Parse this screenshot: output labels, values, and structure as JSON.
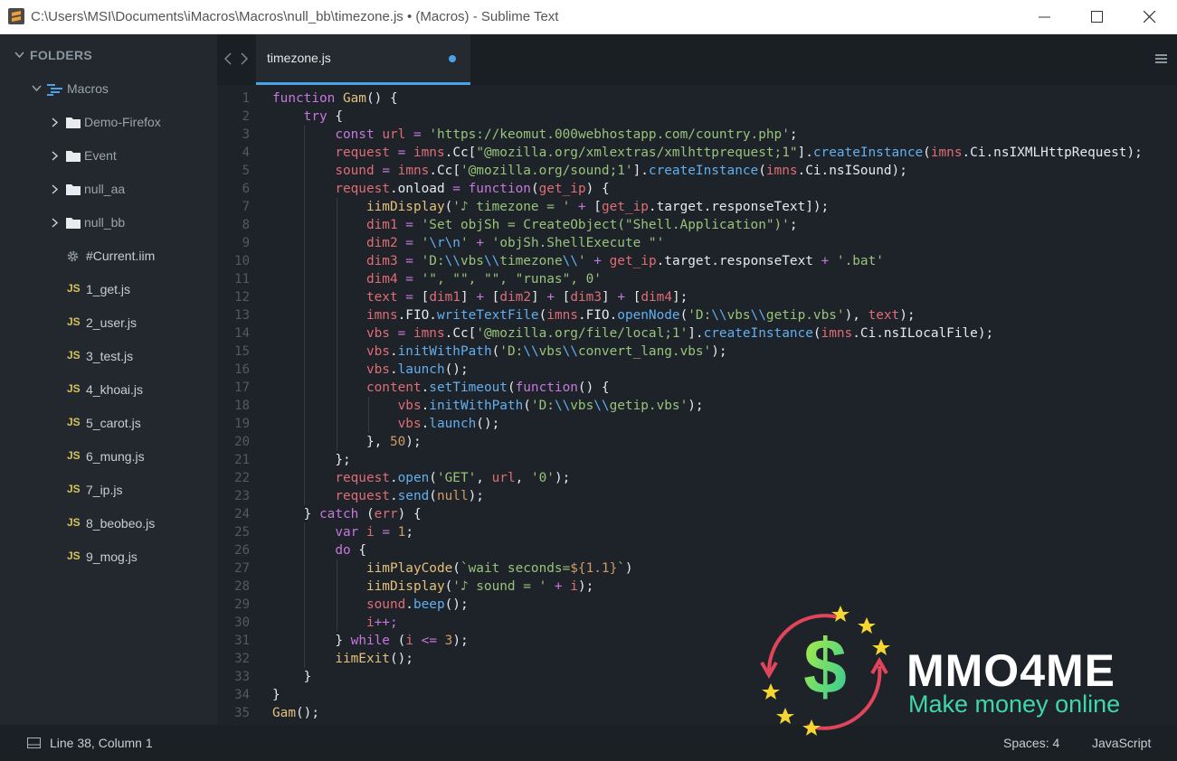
{
  "window": {
    "title": "C:\\Users\\MSI\\Documents\\iMacros\\Macros\\null_bb\\timezone.js • (Macros) - Sublime Text"
  },
  "sidebar": {
    "header": "FOLDERS",
    "root": "Macros",
    "folders": [
      "Demo-Firefox",
      "Event",
      "null_aa",
      "null_bb"
    ],
    "files": [
      {
        "name": "#Current.iim",
        "icon": "gear-icon"
      },
      {
        "name": "1_get.js",
        "icon": "js-file-icon"
      },
      {
        "name": "2_user.js",
        "icon": "js-file-icon"
      },
      {
        "name": "3_test.js",
        "icon": "js-file-icon"
      },
      {
        "name": "4_khoai.js",
        "icon": "js-file-icon"
      },
      {
        "name": "5_carot.js",
        "icon": "js-file-icon"
      },
      {
        "name": "6_mung.js",
        "icon": "js-file-icon"
      },
      {
        "name": "7_ip.js",
        "icon": "js-file-icon"
      },
      {
        "name": "8_beobeo.js",
        "icon": "js-file-icon"
      },
      {
        "name": "9_mog.js",
        "icon": "js-file-icon"
      }
    ],
    "js_badge": "JS"
  },
  "tabs": [
    {
      "label": "timezone.js",
      "active": true,
      "modified": true
    }
  ],
  "editor": {
    "lines": [
      "function Gam() {",
      "    try {",
      "        const url = 'https://keomut.000webhostapp.com/country.php';",
      "        request = imns.Cc[\"@mozilla.org/xmlextras/xmlhttprequest;1\"].createInstance(imns.Ci.nsIXMLHttpRequest);",
      "        sound = imns.Cc['@mozilla.org/sound;1'].createInstance(imns.Ci.nsISound);",
      "        request.onload = function(get_ip) {",
      "            iimDisplay('♪ timezone = ' + [get_ip.target.responseText]);",
      "            dim1 = 'Set objSh = CreateObject(\"Shell.Application\")';",
      "            dim2 = '\\r\\n' + 'objSh.ShellExecute \"'",
      "            dim3 = 'D:\\\\vbs\\\\timezone\\\\' + get_ip.target.responseText + '.bat'",
      "            dim4 = '\", \"\", \"\", \"runas\", 0'",
      "            text = [dim1] + [dim2] + [dim3] + [dim4];",
      "            imns.FIO.writeTextFile(imns.FIO.openNode('D:\\\\vbs\\\\getip.vbs'), text);",
      "            vbs = imns.Cc['@mozilla.org/file/local;1'].createInstance(imns.Ci.nsILocalFile);",
      "            vbs.initWithPath('D:\\\\vbs\\\\convert_lang.vbs');",
      "            vbs.launch();",
      "            content.setTimeout(function() {",
      "                vbs.initWithPath('D:\\\\vbs\\\\getip.vbs');",
      "                vbs.launch();",
      "            }, 50);",
      "        };",
      "        request.open('GET', url, '0');",
      "        request.send(null);",
      "    } catch (err) {",
      "        var i = 1;",
      "        do {",
      "            iimPlayCode(`wait seconds=${1.1}`)",
      "            iimDisplay('♪ sound = ' + i);",
      "            sound.beep();",
      "            i++;",
      "        } while (i <= 3);",
      "        iimExit();",
      "    }",
      "}",
      "Gam();"
    ]
  },
  "status": {
    "position": "Line 38, Column 1",
    "spaces": "Spaces: 4",
    "syntax": "JavaScript"
  },
  "watermark": {
    "brand": "MMO4ME",
    "tagline": "Make money online"
  },
  "colors": {
    "accent": "#4aa3e6",
    "editor_bg": "#1e2329",
    "sidebar_bg": "#22282e",
    "keyword": "#c678dd",
    "function": "#e5c07b",
    "string": "#98c379",
    "variable": "#e06c75",
    "property": "#61afef",
    "number": "#d19a66"
  }
}
